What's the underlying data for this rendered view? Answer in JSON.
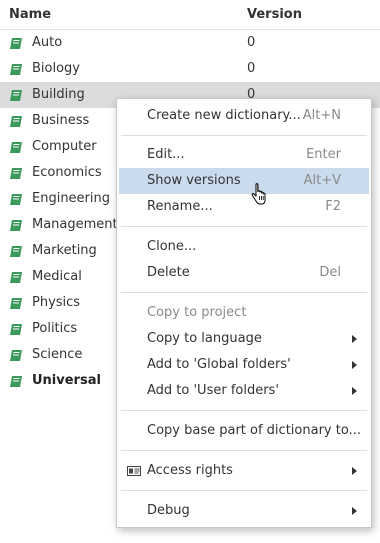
{
  "header": {
    "name": "Name",
    "version": "Version"
  },
  "rows": [
    {
      "name": "Auto",
      "version": "0"
    },
    {
      "name": "Biology",
      "version": "0"
    },
    {
      "name": "Building",
      "version": "0"
    },
    {
      "name": "Business",
      "version": ""
    },
    {
      "name": "Computer",
      "version": ""
    },
    {
      "name": "Economics",
      "version": ""
    },
    {
      "name": "Engineering",
      "version": ""
    },
    {
      "name": "Management",
      "version": ""
    },
    {
      "name": "Marketing",
      "version": ""
    },
    {
      "name": "Medical",
      "version": ""
    },
    {
      "name": "Physics",
      "version": ""
    },
    {
      "name": "Politics",
      "version": ""
    },
    {
      "name": "Science",
      "version": ""
    },
    {
      "name": "Universal",
      "version": ""
    }
  ],
  "menu": {
    "create": {
      "label": "Create new dictionary...",
      "shortcut": "Alt+N"
    },
    "edit": {
      "label": "Edit...",
      "shortcut": "Enter"
    },
    "show_versions": {
      "label": "Show versions",
      "shortcut": "Alt+V"
    },
    "rename": {
      "label": "Rename...",
      "shortcut": "F2"
    },
    "clone": {
      "label": "Clone..."
    },
    "delete": {
      "label": "Delete",
      "shortcut": "Del"
    },
    "copy_to_project": {
      "label": "Copy to project"
    },
    "copy_to_language": {
      "label": "Copy to language"
    },
    "add_global": {
      "label": "Add to 'Global folders'"
    },
    "add_user": {
      "label": "Add to 'User folders'"
    },
    "copy_base": {
      "label": "Copy base part of dictionary to..."
    },
    "access_rights": {
      "label": "Access rights"
    },
    "debug": {
      "label": "Debug"
    }
  },
  "colors": {
    "book_icon": "#3a9a5c",
    "hover_item": "#c9dbec",
    "selected_row": "#dcdcdc"
  }
}
